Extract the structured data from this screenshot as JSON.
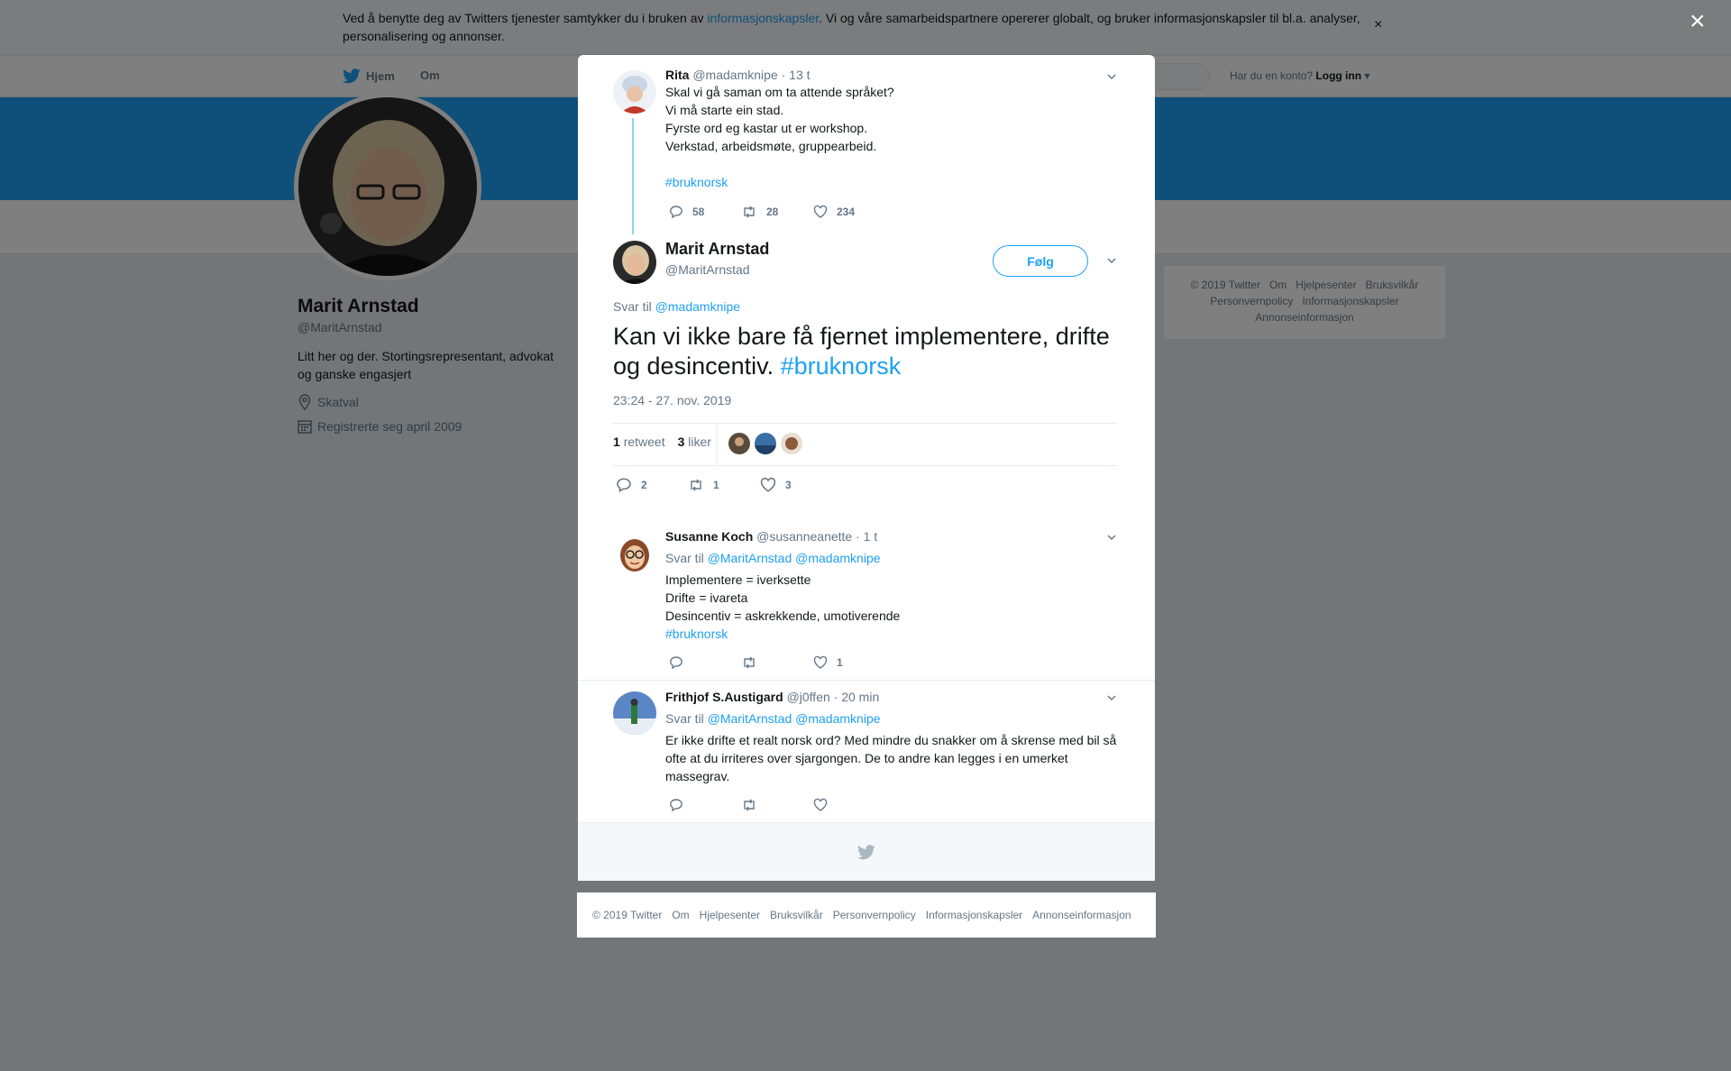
{
  "cookie": {
    "text_before": "Ved å benytte deg av Twitters tjenester samtykker du i bruken av ",
    "link": "informasjonskapsler",
    "text_after": ". Vi og våre samarbeidspartnere opererer globalt, og bruker informasjonskapsler til bl.a. analyser, personalisering og annonser.",
    "close": "×"
  },
  "nav": {
    "home": "Hjem",
    "about": "Om",
    "login_prompt": "Har du en konto?",
    "login": "Logg inn"
  },
  "profile": {
    "name": "Marit Arnstad",
    "handle": "@MaritArnstad",
    "bio": "Litt her og der. Stortingsrepresentant, advokat og ganske engasjert",
    "location": "Skatval",
    "joined": "Registrerte seg april 2009"
  },
  "side_footer": [
    "© 2019 Twitter",
    "Om",
    "Hjelpesenter",
    "Bruksvilkår",
    "Personvernpolicy",
    "Informasjonskapsler",
    "Annonseinformasjon"
  ],
  "overlay": {
    "close": "×"
  },
  "parent_tweet": {
    "name": "Rita",
    "handle": "@madamknipe",
    "time": "· 13 t",
    "lines": [
      "Skal vi gå saman om ta attende språket?",
      "Vi må starte ein stad.",
      "Fyrste ord eg kastar ut er workshop.",
      "Verkstad, arbeidsmøte, gruppearbeid."
    ],
    "hashtag": "#bruknorsk",
    "replies": "58",
    "retweets": "28",
    "likes": "234"
  },
  "main_tweet": {
    "name": "Marit Arnstad",
    "handle": "@MaritArnstad",
    "follow": "Følg",
    "reply_to_label": "Svar til",
    "reply_to": "@madamknipe",
    "text": "Kan vi ikke bare få fjernet implementere, drifte og desincentiv.",
    "hashtag": "#bruknorsk",
    "timestamp": "23:24 - 27. nov. 2019",
    "retweet_count": "1",
    "retweet_label": "retweet",
    "like_count": "3",
    "like_label": "liker",
    "replies": "2",
    "retweets": "1",
    "likes": "3"
  },
  "replies": [
    {
      "name": "Susanne Koch",
      "handle": "@susanneanette",
      "time": "· 1 t",
      "reply_to_label": "Svar til",
      "reply_to": "@MaritArnstad @madamknipe",
      "lines": [
        "Implementere = iverksette",
        "Drifte = ivareta",
        "Desincentiv = askrekkende, umotiverende"
      ],
      "hashtag": "#bruknorsk",
      "likes": "1"
    },
    {
      "name": "Frithjof S.Austigard",
      "handle": "@j0ffen",
      "time": "· 20 min",
      "reply_to_label": "Svar til",
      "reply_to": "@MaritArnstad @madamknipe",
      "text": "Er ikke drifte et realt norsk ord? Med mindre du snakker om å skrense med bil så ofte at du irriteres over sjargongen. De to andre kan legges i en umerket massegrav."
    }
  ],
  "footer": [
    "© 2019 Twitter",
    "Om",
    "Hjelpesenter",
    "Bruksvilkår",
    "Personvernpolicy",
    "Informasjonskapsler",
    "Annonseinformasjon"
  ],
  "colors": {
    "accent": "#1da1f2",
    "muted": "#657786"
  }
}
